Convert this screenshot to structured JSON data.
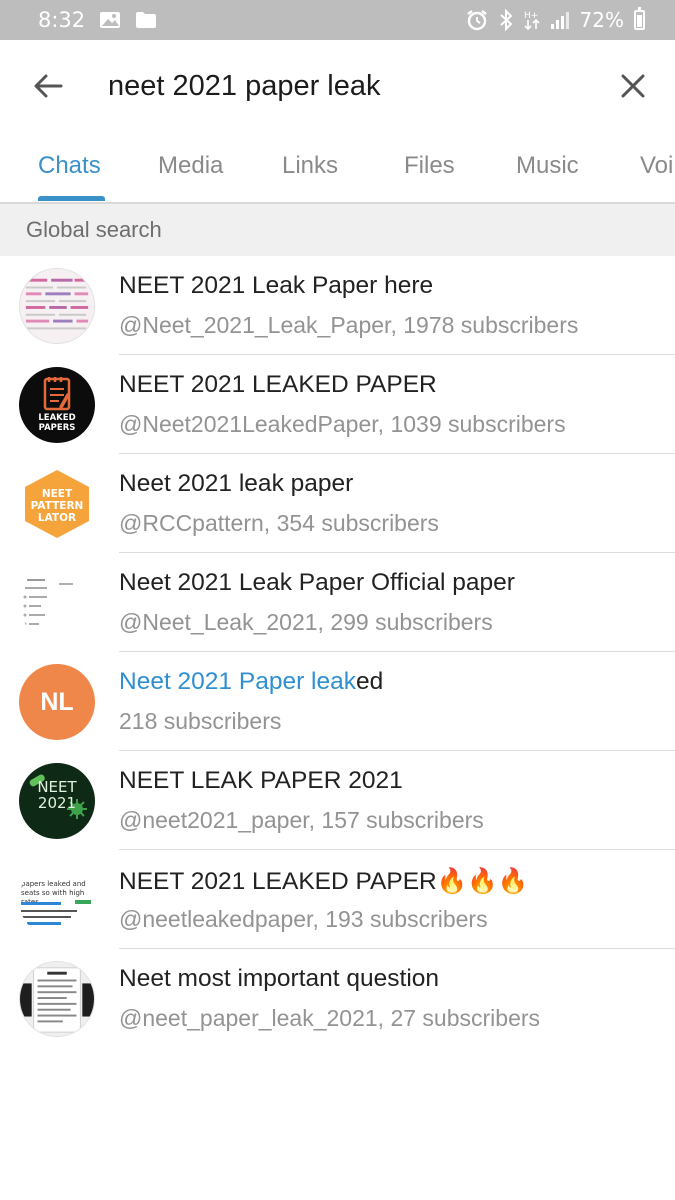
{
  "status_bar": {
    "time": "8:32",
    "battery": "72%",
    "battery_level": 0.72,
    "icons_left": [
      "image-icon",
      "folder-icon"
    ],
    "icons_right": [
      "alarm-icon",
      "bluetooth-icon",
      "data-arrows-icon",
      "signal-icon",
      "battery-icon"
    ]
  },
  "search": {
    "query": "neet 2021 paper leak",
    "back_icon": "arrow-left-icon",
    "close_icon": "close-icon"
  },
  "tabs": [
    {
      "label": "Chats",
      "active": true
    },
    {
      "label": "Media",
      "active": false
    },
    {
      "label": "Links",
      "active": false
    },
    {
      "label": "Files",
      "active": false
    },
    {
      "label": "Music",
      "active": false
    },
    {
      "label": "Voi",
      "active": false
    }
  ],
  "section": {
    "title": "Global search"
  },
  "results": [
    {
      "title": "NEET 2021 Leak Paper here",
      "subtitle": "@Neet_2021_Leak_Paper, 1978 subscribers",
      "avatar": "newspaper-clipping"
    },
    {
      "title": "NEET 2021 LEAKED PAPER",
      "subtitle": "@Neet2021LeakedPaper, 1039 subscribers",
      "avatar": "leaked-papers-logo",
      "avatar_text": "LEAKED PAPERS"
    },
    {
      "title": "Neet 2021 leak paper",
      "subtitle": "@RCCpattern, 354 subscribers",
      "avatar": "neet-pattern-hexagon",
      "avatar_text": "NEET PATTERN LATOR"
    },
    {
      "title": "Neet 2021 Leak Paper Official paper",
      "subtitle": "@Neet_Leak_2021, 299 subscribers",
      "avatar": "text-document"
    },
    {
      "title_highlight": "Neet 2021 Paper leak",
      "title_rest": "ed",
      "subtitle": "218 subscribers",
      "avatar": "initials",
      "avatar_initials": "NL",
      "avatar_color": "#f0874a"
    },
    {
      "title": "NEET LEAK PAPER 2021",
      "subtitle": "@neet2021_paper, 157 subscribers",
      "avatar": "neet-2021-green",
      "avatar_text": "NEET 2021"
    },
    {
      "title": "NEET 2021 LEAKED PAPER🔥🔥🔥",
      "subtitle": "@neetleakedpaper, 193 subscribers",
      "avatar": "tweet-screenshot",
      "avatar_text": "papers leaked and seats so with high rates"
    },
    {
      "title": "Neet most important question",
      "subtitle": "@neet_paper_leak_2021, 27 subscribers",
      "avatar": "question-sheet"
    }
  ],
  "colors": {
    "accent": "#3a90c9",
    "highlight": "#2f8fd1",
    "status_bar_bg": "#bdbdbd",
    "section_bg": "#f0f0f0",
    "nl_avatar": "#f0874a"
  }
}
